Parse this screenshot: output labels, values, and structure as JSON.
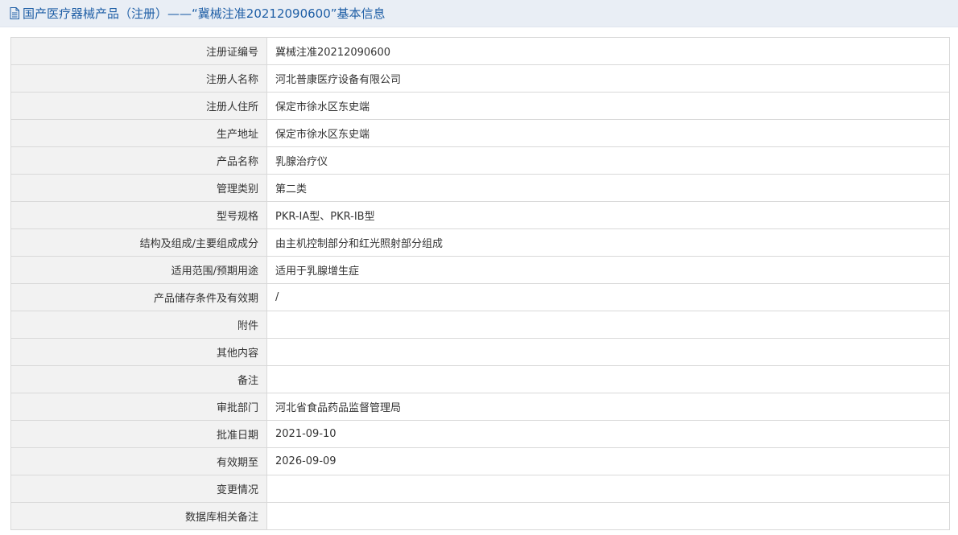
{
  "header": {
    "icon": "document-icon",
    "title": "国产医疗器械产品（注册）——“冀械注准20212090600”基本信息",
    "color": "#1f5fa6"
  },
  "rows": [
    {
      "label": "注册证编号",
      "value": "冀械注准20212090600"
    },
    {
      "label": "注册人名称",
      "value": "河北普康医疗设备有限公司"
    },
    {
      "label": "注册人住所",
      "value": "保定市徐水区东史端"
    },
    {
      "label": "生产地址",
      "value": "保定市徐水区东史端"
    },
    {
      "label": "产品名称",
      "value": "乳腺治疗仪"
    },
    {
      "label": "管理类别",
      "value": "第二类"
    },
    {
      "label": "型号规格",
      "value": "PKR-IA型、PKR-IB型"
    },
    {
      "label": "结构及组成/主要组成成分",
      "value": "由主机控制部分和红光照射部分组成"
    },
    {
      "label": "适用范围/预期用途",
      "value": "适用于乳腺增生症"
    },
    {
      "label": "产品储存条件及有效期",
      "value": "/"
    },
    {
      "label": "附件",
      "value": ""
    },
    {
      "label": "其他内容",
      "value": ""
    },
    {
      "label": "备注",
      "value": ""
    },
    {
      "label": "审批部门",
      "value": "河北省食品药品监督管理局"
    },
    {
      "label": "批准日期",
      "value": "2021-09-10"
    },
    {
      "label": "有效期至",
      "value": "2026-09-09"
    },
    {
      "label": "变更情况",
      "value": ""
    },
    {
      "label": "数据库相关备注",
      "value": ""
    }
  ]
}
